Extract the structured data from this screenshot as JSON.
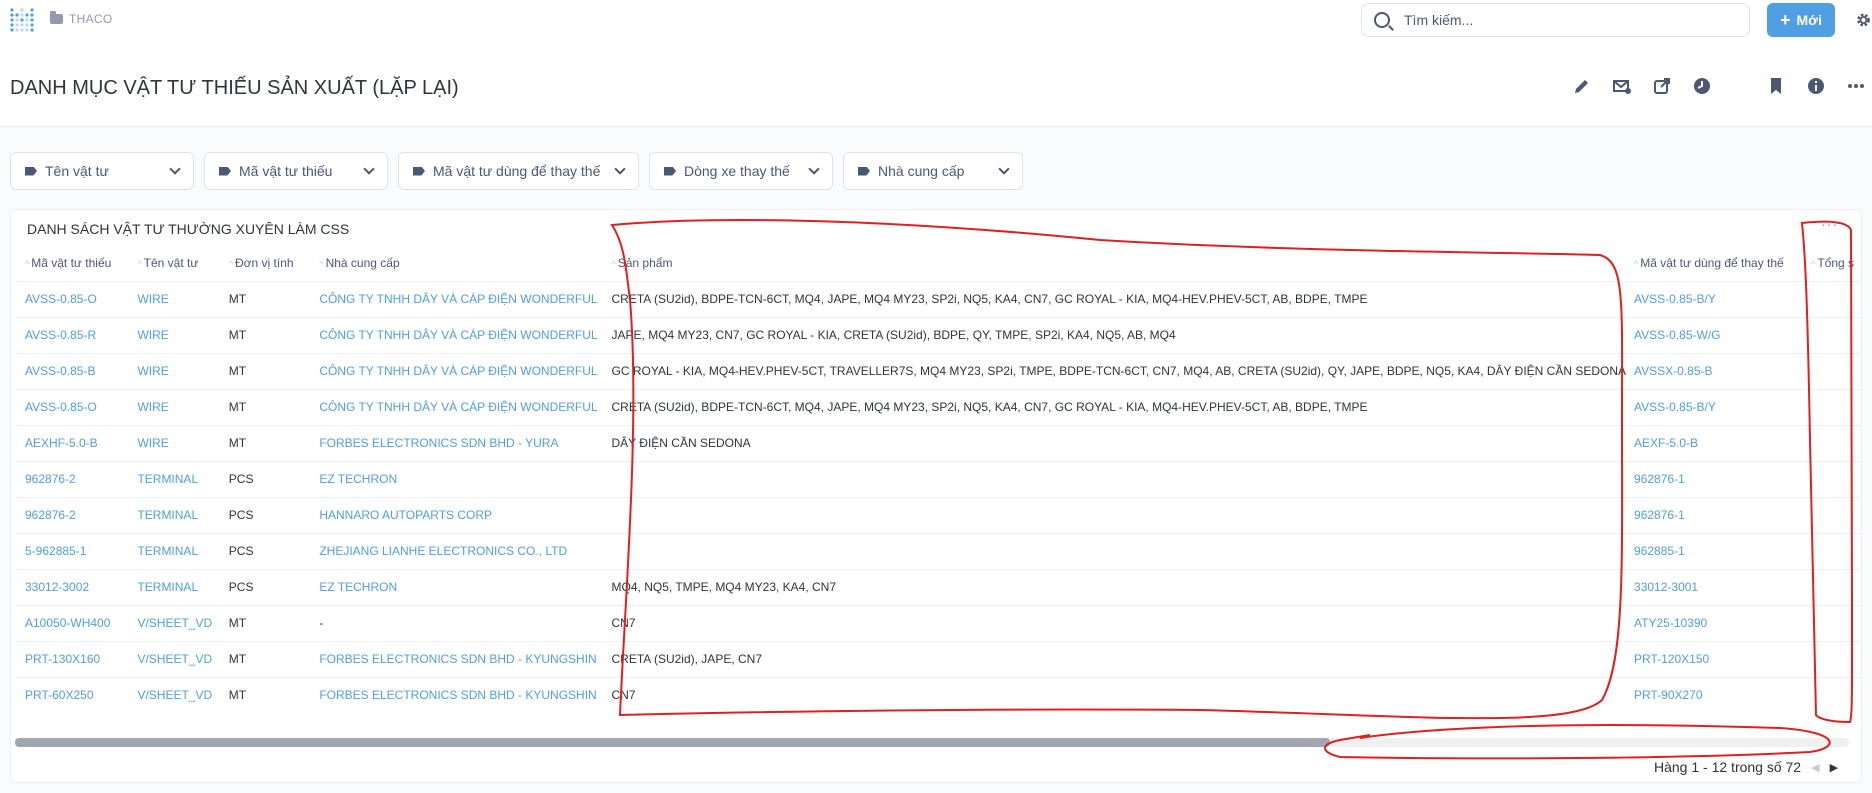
{
  "topbar": {
    "breadcrumb": "THACO",
    "search_placeholder": "Tìm kiếm...",
    "new_label": "Mới"
  },
  "page": {
    "title": "DANH MỤC VẬT TƯ THIẾU SẢN XUẤT (LẶP LẠI)"
  },
  "filters": [
    {
      "label": "Tên vật tư"
    },
    {
      "label": "Mã vật tư thiếu"
    },
    {
      "label": "Mã vật tư dùng để thay thế"
    },
    {
      "label": "Dòng xe thay thế"
    },
    {
      "label": "Nhà cung cấp"
    }
  ],
  "card": {
    "title": "DANH SÁCH VẬT TƯ THƯỜNG XUYÊN LÀM CSS",
    "more": "···",
    "columns": [
      "Mã vật tư thiếu",
      "Tên vật tư",
      "Đơn vị tính",
      "Nhà cung cấp",
      "Sản phẩm",
      "Mã vật tư dùng để thay thế",
      "Tổng s"
    ],
    "rows": [
      [
        "AVSS-0.85-O",
        "WIRE",
        "MT",
        "CÔNG TY TNHH DÂY VÀ CÁP ĐIỆN WONDERFUL",
        "CRETA (SU2id), BDPE-TCN-6CT, MQ4, JAPE, MQ4 MY23, SP2i, NQ5, KA4, CN7, GC ROYAL - KIA, MQ4-HEV.PHEV-5CT, AB, BDPE, TMPE",
        "AVSS-0.85-B/Y",
        ""
      ],
      [
        "AVSS-0.85-R",
        "WIRE",
        "MT",
        "CÔNG TY TNHH DÂY VÀ CÁP ĐIỆN WONDERFUL",
        "JAPE, MQ4 MY23, CN7, GC ROYAL - KIA, CRETA (SU2id), BDPE, QY, TMPE, SP2i, KA4, NQ5, AB, MQ4",
        "AVSS-0.85-W/G",
        ""
      ],
      [
        "AVSS-0.85-B",
        "WIRE",
        "MT",
        "CÔNG TY TNHH DÂY VÀ CÁP ĐIỆN WONDERFUL",
        "GC ROYAL - KIA, MQ4-HEV.PHEV-5CT, TRAVELLER7S, MQ4 MY23, SP2i, TMPE, BDPE-TCN-6CT, CN7, MQ4, AB, CRETA (SU2id), QY, JAPE, BDPE, NQ5, KA4, DÂY ĐIỆN CẦN SEDONA",
        "AVSSX-0.85-B",
        ""
      ],
      [
        "AVSS-0.85-O",
        "WIRE",
        "MT",
        "CÔNG TY TNHH DÂY VÀ CÁP ĐIỆN WONDERFUL",
        "CRETA (SU2id), BDPE-TCN-6CT, MQ4, JAPE, MQ4 MY23, SP2i, NQ5, KA4, CN7, GC ROYAL - KIA, MQ4-HEV.PHEV-5CT, AB, BDPE, TMPE",
        "AVSS-0.85-B/Y",
        ""
      ],
      [
        "AEXHF-5.0-B",
        "WIRE",
        "MT",
        "FORBES ELECTRONICS SDN BHD - YURA",
        "DÂY ĐIỆN CẦN SEDONA",
        "AEXF-5.0-B",
        ""
      ],
      [
        "962876-2",
        "TERMINAL",
        "PCS",
        "EZ TECHRON",
        "",
        "962876-1",
        ""
      ],
      [
        "962876-2",
        "TERMINAL",
        "PCS",
        "HANNARO AUTOPARTS CORP",
        "",
        "962876-1",
        ""
      ],
      [
        "5-962885-1",
        "TERMINAL",
        "PCS",
        "ZHEJIANG LIANHE ELECTRONICS CO., LTD",
        "",
        "962885-1",
        ""
      ],
      [
        "33012-3002",
        "TERMINAL",
        "PCS",
        "EZ TECHRON",
        "MQ4, NQ5, TMPE, MQ4 MY23, KA4, CN7",
        "33012-3001",
        ""
      ],
      [
        "A10050-WH400",
        "V/SHEET_VD",
        "MT",
        "-",
        "CN7",
        "ATY25-10390",
        ""
      ],
      [
        "PRT-130X160",
        "V/SHEET_VD",
        "MT",
        "FORBES ELECTRONICS SDN BHD - KYUNGSHIN",
        "CRETA (SU2id), JAPE, CN7",
        "PRT-120X150",
        ""
      ],
      [
        "PRT-60X250",
        "V/SHEET_VD",
        "MT",
        "FORBES ELECTRONICS SDN BHD - KYUNGSHIN",
        "CN7",
        "PRT-90X270",
        ""
      ]
    ],
    "pager": "Hàng 1 - 12 trong số 72"
  },
  "colors": {
    "accent": "#509ee3",
    "annotation": "#e02020"
  }
}
